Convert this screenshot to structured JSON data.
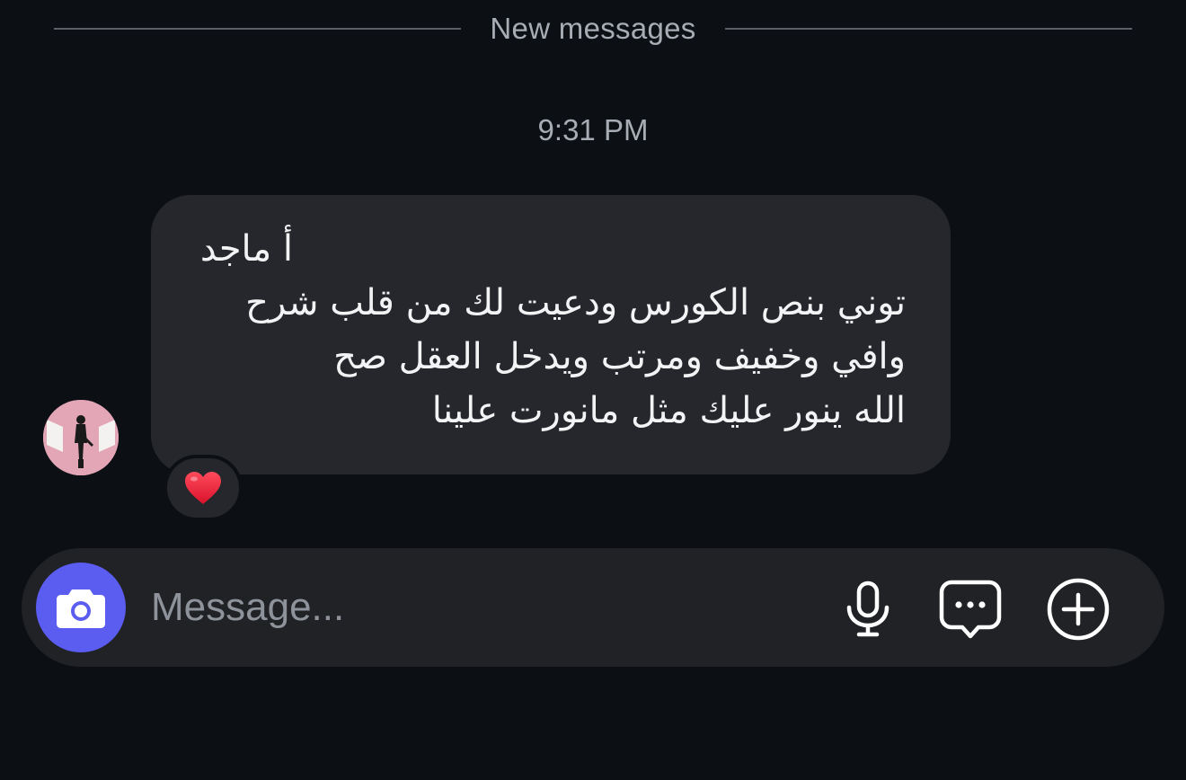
{
  "divider": {
    "label": "New messages"
  },
  "conversation": {
    "timestamp": "9:31 PM",
    "message": {
      "lines": [
        "أ ماجد",
        "توني بنص الكورس ودعيت لك من قلب شرح",
        "وافي وخفيف ومرتب ويدخل العقل صح",
        "الله ينور عليك مثل مانورت علينا"
      ],
      "reaction": "❤️"
    }
  },
  "composer": {
    "placeholder": "Message...",
    "value": ""
  },
  "icons": {
    "camera": "camera-icon",
    "mic": "microphone-icon",
    "sticker": "chat-bubble-icon",
    "add": "plus-circle-icon"
  },
  "colors": {
    "background": "#0c0f14",
    "bubble": "#25272c",
    "accent": "#5b5cf0",
    "text": "#f2f3f5",
    "muted": "#a8adb5"
  }
}
